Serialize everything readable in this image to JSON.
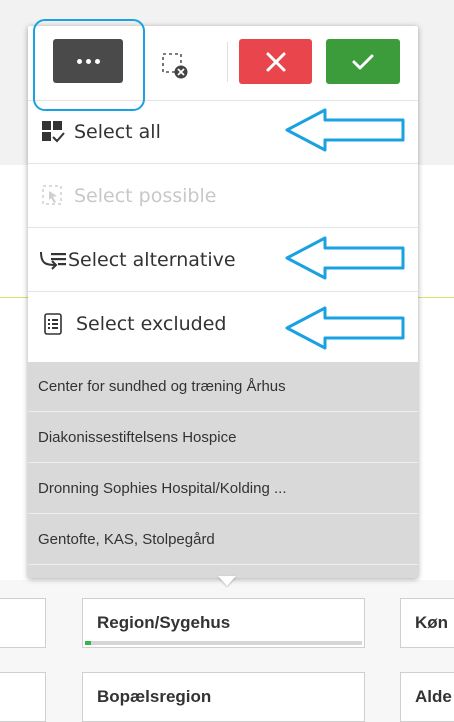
{
  "toolbar": {
    "more_icon": "ellipsis-icon",
    "clear_icon": "clear-selection-icon",
    "cancel_icon": "close-icon",
    "confirm_icon": "check-icon",
    "colors": {
      "more": "#4a4a4a",
      "cancel": "#e8464c",
      "confirm": "#3c9c3c",
      "annotation": "#1aa1e1"
    }
  },
  "menu": {
    "items": [
      {
        "label": "Select all",
        "icon": "select-all-icon",
        "enabled": true
      },
      {
        "label": "Select possible",
        "icon": "select-possible-icon",
        "enabled": false
      },
      {
        "label": "Select alternative",
        "icon": "select-alternative-icon",
        "enabled": true
      },
      {
        "label": "Select excluded",
        "icon": "select-excluded-icon",
        "enabled": true
      }
    ]
  },
  "list": {
    "rows": [
      "Center for sundhed og træning Århus",
      "Diakonissestiftelsens Hospice",
      "Dronning Sophies Hospital/Kolding ...",
      "Gentofte, KAS, Stolpegård"
    ]
  },
  "fields": {
    "region": "Region/Sygehus",
    "koen": "Køn",
    "bopael": "Bopælsregion",
    "alder": "Alde"
  }
}
